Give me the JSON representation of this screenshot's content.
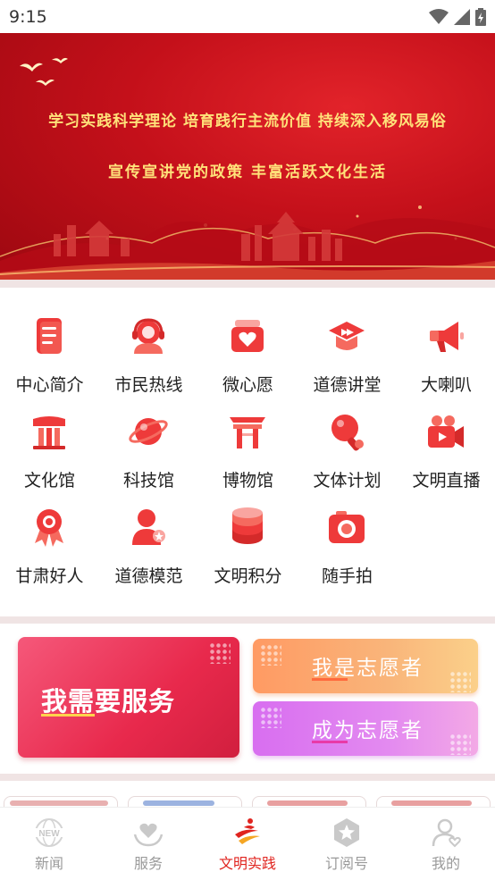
{
  "status_bar": {
    "time": "9:15"
  },
  "banner": {
    "line1": "学习实践科学理论  培育践行主流价值  持续深入移风易俗",
    "line2": "宣传宣讲党的政策    丰富活跃文化生活"
  },
  "grid": {
    "items": [
      {
        "label": "中心简介",
        "icon": "document-icon"
      },
      {
        "label": "市民热线",
        "icon": "headset-icon"
      },
      {
        "label": "微心愿",
        "icon": "heart-box-icon"
      },
      {
        "label": "道德讲堂",
        "icon": "graduation-cap-icon"
      },
      {
        "label": "大喇叭",
        "icon": "megaphone-icon"
      },
      {
        "label": "文化馆",
        "icon": "book-building-icon"
      },
      {
        "label": "科技馆",
        "icon": "planet-icon"
      },
      {
        "label": "博物馆",
        "icon": "ancient-gate-icon"
      },
      {
        "label": "文体计划",
        "icon": "ping-pong-icon"
      },
      {
        "label": "文明直播",
        "icon": "video-camera-icon"
      },
      {
        "label": "甘肃好人",
        "icon": "award-ribbon-icon"
      },
      {
        "label": "道德模范",
        "icon": "person-star-icon"
      },
      {
        "label": "文明积分",
        "icon": "coin-stack-icon"
      },
      {
        "label": "随手拍",
        "icon": "camera-icon"
      }
    ]
  },
  "cards": {
    "need_service": "我需要服务",
    "i_am_volunteer": "我是志愿者",
    "become_volunteer": "成为志愿者"
  },
  "tabbar": {
    "tabs": [
      {
        "label": "新闻",
        "icon": "news-globe-icon",
        "active": false
      },
      {
        "label": "服务",
        "icon": "heart-hands-icon",
        "active": false
      },
      {
        "label": "文明实践",
        "icon": "civilization-logo-icon",
        "active": true
      },
      {
        "label": "订阅号",
        "icon": "star-badge-icon",
        "active": false
      },
      {
        "label": "我的",
        "icon": "user-heart-icon",
        "active": false
      }
    ]
  },
  "colors": {
    "brand_red": "#e0241f",
    "banner_gold": "#ffe27a",
    "card_red": "#e8294c",
    "card_orange": "#f9b57a",
    "card_purple": "#e38af0"
  }
}
